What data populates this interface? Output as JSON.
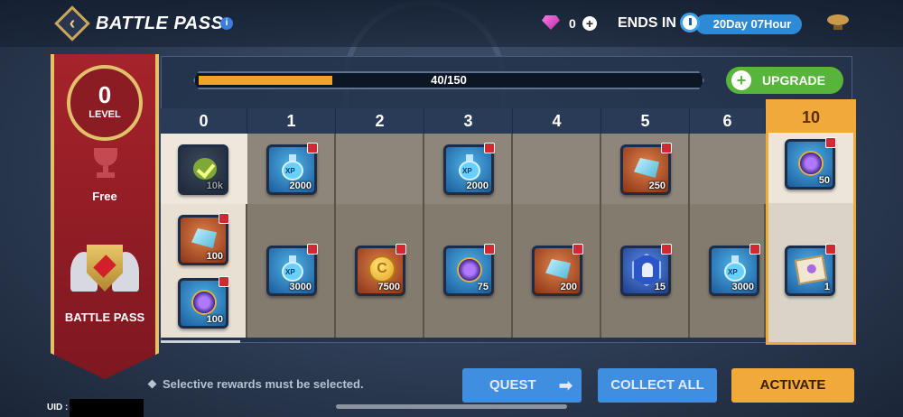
{
  "header": {
    "title": "BATTLE PASS",
    "info": "i",
    "gems": "0",
    "plus": "+",
    "ends_label": "ENDS IN",
    "ends_value": "20Day 07Hour"
  },
  "banner": {
    "level": "0",
    "level_label": "LEVEL",
    "free_label": "Free",
    "bp_label": "BATTLE PASS"
  },
  "progress": {
    "text": "40/150",
    "fraction": 0.267
  },
  "upgrade": {
    "plus": "+",
    "label": "UPGRADE"
  },
  "columns": [
    "0",
    "1",
    "2",
    "3",
    "4",
    "5",
    "6",
    "10"
  ],
  "rewards": {
    "c0_free": "10k",
    "c0_bp1": "100",
    "c0_bp2": "100",
    "c1_free": "2000",
    "c1_bp": "3000",
    "c2_bp": "7500",
    "c3_free": "2000",
    "c3_bp": "75",
    "c4_bp": "200",
    "c5_free": "250",
    "c5_bp": "15",
    "c6_bp": "3000",
    "c10_free": "50",
    "c10_bp": "1"
  },
  "glyphs": {
    "xp": "XP",
    "coin": "C"
  },
  "note": "Selective rewards must be selected.",
  "buttons": {
    "quest": "QUEST",
    "quest_arrow": "➡",
    "collect_all": "COLLECT ALL",
    "activate": "ACTIVATE"
  },
  "uid_label": "UID :",
  "colors": {
    "accent": "#f1a93a",
    "progress": "#f2a224",
    "upgrade": "#58b53c",
    "button_blue": "#3f8ee0",
    "banner_red": "#a6232b"
  }
}
